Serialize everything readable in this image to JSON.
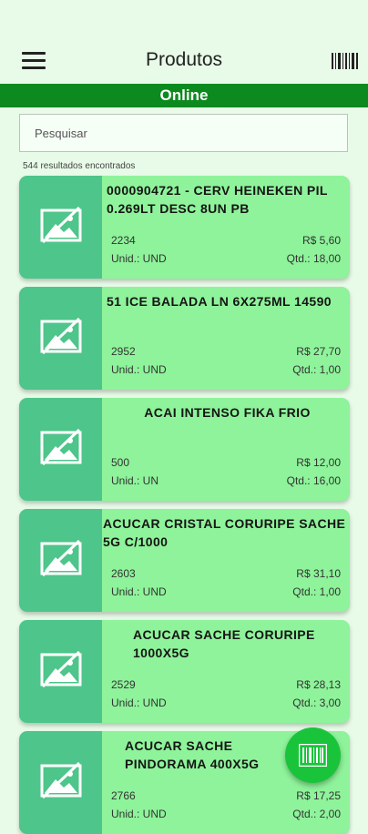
{
  "header": {
    "title": "Produtos",
    "menu_icon": "menu-icon",
    "scan_icon": "barcode-icon"
  },
  "status": {
    "label": "Online",
    "color": "#0d8a1f"
  },
  "search": {
    "placeholder": "Pesquisar",
    "value": ""
  },
  "results": {
    "count_text": "544 resultados encontrados"
  },
  "colors": {
    "card_bg": "#8ef39a",
    "thumb_bg": "#4ec58a",
    "fab_bg": "#19c43a",
    "page_bg": "#e8fbe8"
  },
  "products": [
    {
      "name": "0000904721 - CERV HEINEKEN PIL 0.269LT DESC 8UN PB",
      "code": "2234",
      "unit": "Unid.: UND",
      "price": "R$ 5,60",
      "qty": "Qtd.: 18,00",
      "align": "left"
    },
    {
      "name": "51 ICE BALADA LN 6X275ML 14590",
      "code": "2952",
      "unit": "Unid.: UND",
      "price": "R$ 27,70",
      "qty": "Qtd.: 1,00",
      "align": "left"
    },
    {
      "name": "ACAI INTENSO  FIKA FRIO",
      "code": "500",
      "unit": "Unid.: UN",
      "price": "R$ 12,00",
      "qty": "Qtd.: 16,00",
      "align": "center"
    },
    {
      "name": "ACUCAR CRISTAL CORURIPE SACHE 5G C/1000",
      "code": "2603",
      "unit": "Unid.: UND",
      "price": "R$ 31,10",
      "qty": "Qtd.: 1,00",
      "align": "left"
    },
    {
      "name": "ACUCAR SACHE CORURIPE 1000X5G",
      "code": "2529",
      "unit": "Unid.: UND",
      "price": "R$ 28,13",
      "qty": "Qtd.: 3,00",
      "align": "center"
    },
    {
      "name": "ACUCAR SACHE PINDORAMA 400X5G",
      "code": "2766",
      "unit": "Unid.: UND",
      "price": "R$ 17,25",
      "qty": "Qtd.: 2,00",
      "align": "center"
    }
  ],
  "fab": {
    "icon": "barcode-scan-icon"
  }
}
